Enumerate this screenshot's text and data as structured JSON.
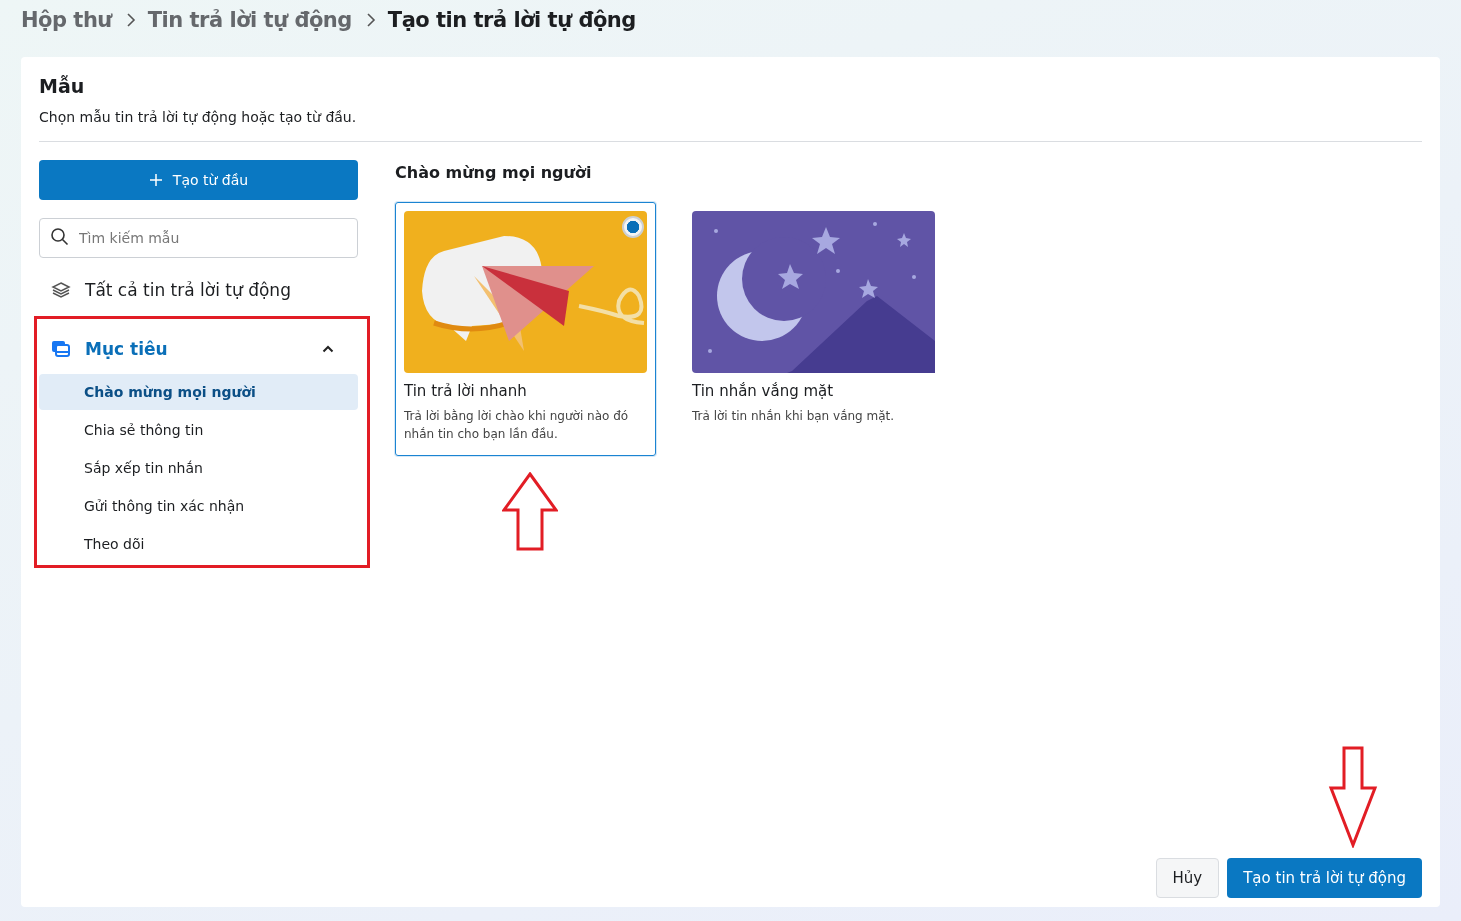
{
  "breadcrumb": [
    {
      "label": "Hộp thư",
      "current": false
    },
    {
      "label": "Tin trả lời tự động",
      "current": false
    },
    {
      "label": "Tạo tin trả lời tự động",
      "current": true
    }
  ],
  "panel": {
    "title": "Mẫu",
    "subtitle": "Chọn mẫu tin trả lời tự động hoặc tạo từ đầu."
  },
  "sidebar": {
    "create_button": "Tạo từ đầu",
    "search": {
      "placeholder": "Tìm kiếm mẫu"
    },
    "all_item": "Tất cả tin trả lời tự động",
    "section": {
      "label": "Mục tiêu",
      "expanded": true,
      "items": [
        {
          "label": "Chào mừng mọi người",
          "selected": true
        },
        {
          "label": "Chia sẻ thông tin",
          "selected": false
        },
        {
          "label": "Sắp xếp tin nhắn",
          "selected": false
        },
        {
          "label": "Gửi thông tin xác nhận",
          "selected": false
        },
        {
          "label": "Theo dõi",
          "selected": false
        }
      ]
    }
  },
  "content": {
    "heading": "Chào mừng mọi người",
    "templates": [
      {
        "kind": "plane",
        "title": "Tin trả lời nhanh",
        "description": "Trả lời bằng lời chào khi người nào đó nhắn tin cho bạn lần đầu.",
        "selected": true
      },
      {
        "kind": "moon",
        "title": "Tin nhắn vắng mặt",
        "description": "Trả lời tin nhắn khi bạn vắng mặt.",
        "selected": false
      }
    ]
  },
  "footer": {
    "cancel": "Hủy",
    "submit": "Tạo tin trả lời tự động"
  }
}
